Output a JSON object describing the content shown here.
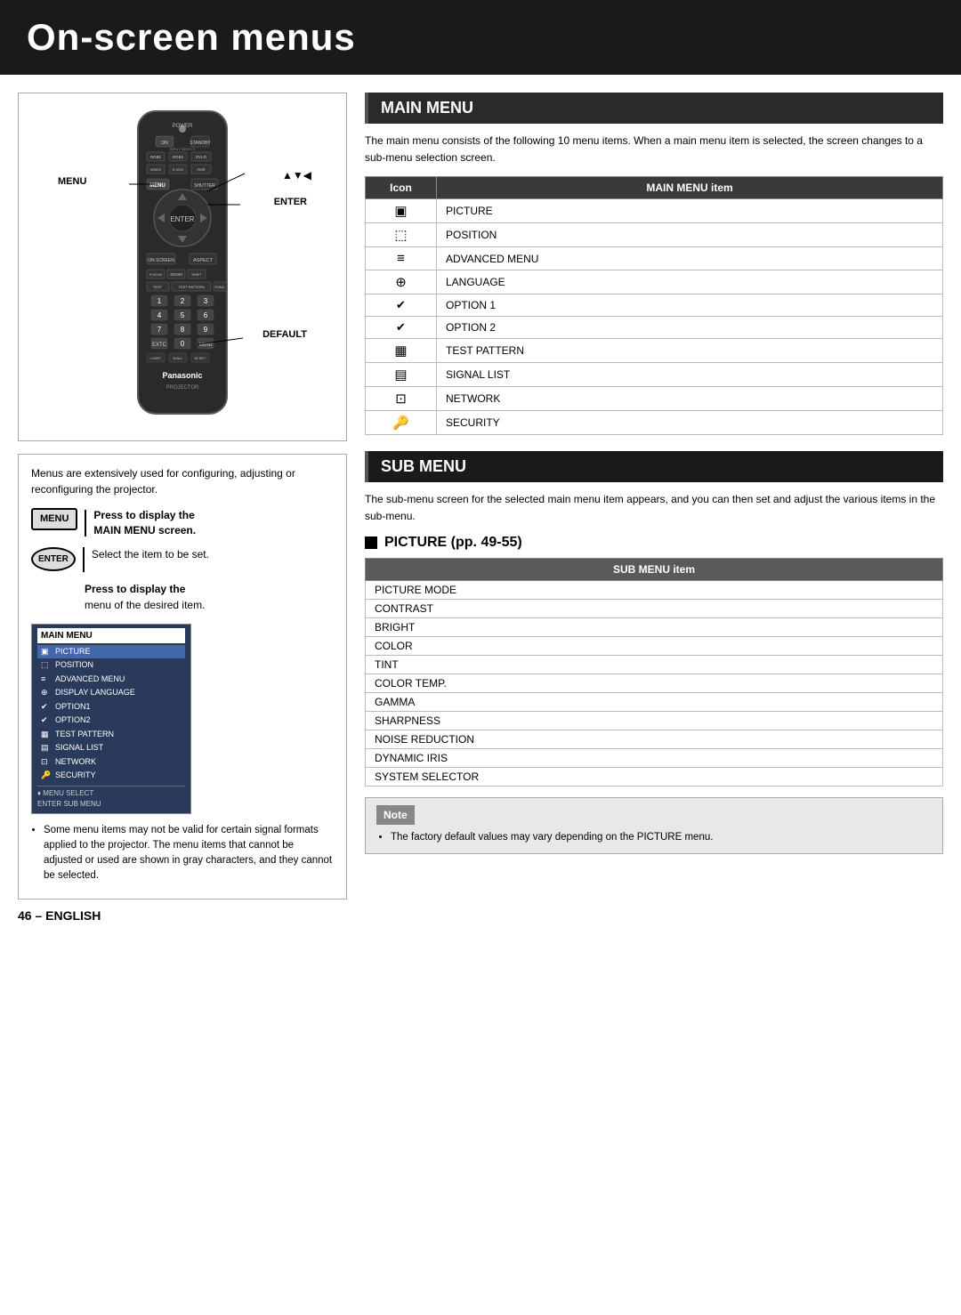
{
  "page": {
    "title": "On-screen menus",
    "page_number": "46 – ENGLISH"
  },
  "main_menu": {
    "section_title": "MAIN MENU",
    "description": "The main menu consists of the following 10 menu items. When a main menu item is selected, the screen changes to a sub-menu selection screen.",
    "table_header_icon": "Icon",
    "table_header_item": "MAIN MENU item",
    "items": [
      {
        "icon": "▣",
        "label": "PICTURE"
      },
      {
        "icon": "⬚",
        "label": "POSITION"
      },
      {
        "icon": "≡",
        "label": "ADVANCED MENU"
      },
      {
        "icon": "⊕",
        "label": "LANGUAGE"
      },
      {
        "icon": "✔",
        "label": "OPTION 1"
      },
      {
        "icon": "✔",
        "label": "OPTION 2"
      },
      {
        "icon": "▦",
        "label": "TEST PATTERN"
      },
      {
        "icon": "▤",
        "label": "SIGNAL LIST"
      },
      {
        "icon": "⊡",
        "label": "NETWORK"
      },
      {
        "icon": "🔑",
        "label": "SECURITY"
      }
    ]
  },
  "sub_menu": {
    "section_title": "SUB MENU",
    "description": "The sub-menu screen for the selected main menu item appears, and you can then set and adjust the various items in the sub-menu.",
    "picture_section": {
      "title": "PICTURE (pp. 49-55)",
      "table_header": "SUB MENU item",
      "items": [
        "PICTURE MODE",
        "CONTRAST",
        "BRIGHT",
        "COLOR",
        "TINT",
        "COLOR TEMP.",
        "GAMMA",
        "SHARPNESS",
        "NOISE REDUCTION",
        "DYNAMIC IRIS",
        "SYSTEM SELECTOR"
      ]
    }
  },
  "note": {
    "title": "Note",
    "text": "The factory default values may vary depending on the PICTURE menu."
  },
  "left_panel": {
    "remote_labels": {
      "menu": "MENU",
      "enter": "ENTER",
      "arrows": "▲▼◀",
      "default": "DEFAULT"
    },
    "info_text": "Menus are extensively used for configuring, adjusting or reconfiguring the projector.",
    "menu_btn": "MENU",
    "menu_desc_bold": "Press to display the",
    "menu_desc_bold2": "MAIN MENU screen.",
    "enter_btn": "ENTER",
    "enter_desc": "Select the item to be set.",
    "enter_desc2_bold": "Press to display the",
    "enter_desc2": "menu of the desired item.",
    "bullet_items": [
      "Some menu items may not be valid for certain signal formats applied to the projector. The menu items that cannot be adjusted or used are shown in gray characters, and they cannot be selected."
    ],
    "screen_menu": {
      "title": "MAIN MENU",
      "items": [
        {
          "icon": "▣",
          "label": "PICTURE",
          "active": true
        },
        {
          "icon": "⬚",
          "label": "POSITION",
          "active": false
        },
        {
          "icon": "≡",
          "label": "ADVANCED MENU",
          "active": false
        },
        {
          "icon": "⊕",
          "label": "DISPLAY LANGUAGE",
          "active": false
        },
        {
          "icon": "✔",
          "label": "OPTION1",
          "active": false
        },
        {
          "icon": "✔",
          "label": "OPTION2",
          "active": false
        },
        {
          "icon": "▦",
          "label": "TEST PATTERN",
          "active": false
        },
        {
          "icon": "▤",
          "label": "SIGNAL LIST",
          "active": false
        },
        {
          "icon": "⊡",
          "label": "NETWORK",
          "active": false
        },
        {
          "icon": "🔑",
          "label": "SECURITY",
          "active": false
        }
      ],
      "footer1": "♦ MENU SELECT",
      "footer2": "ENTER SUB MENU"
    }
  }
}
